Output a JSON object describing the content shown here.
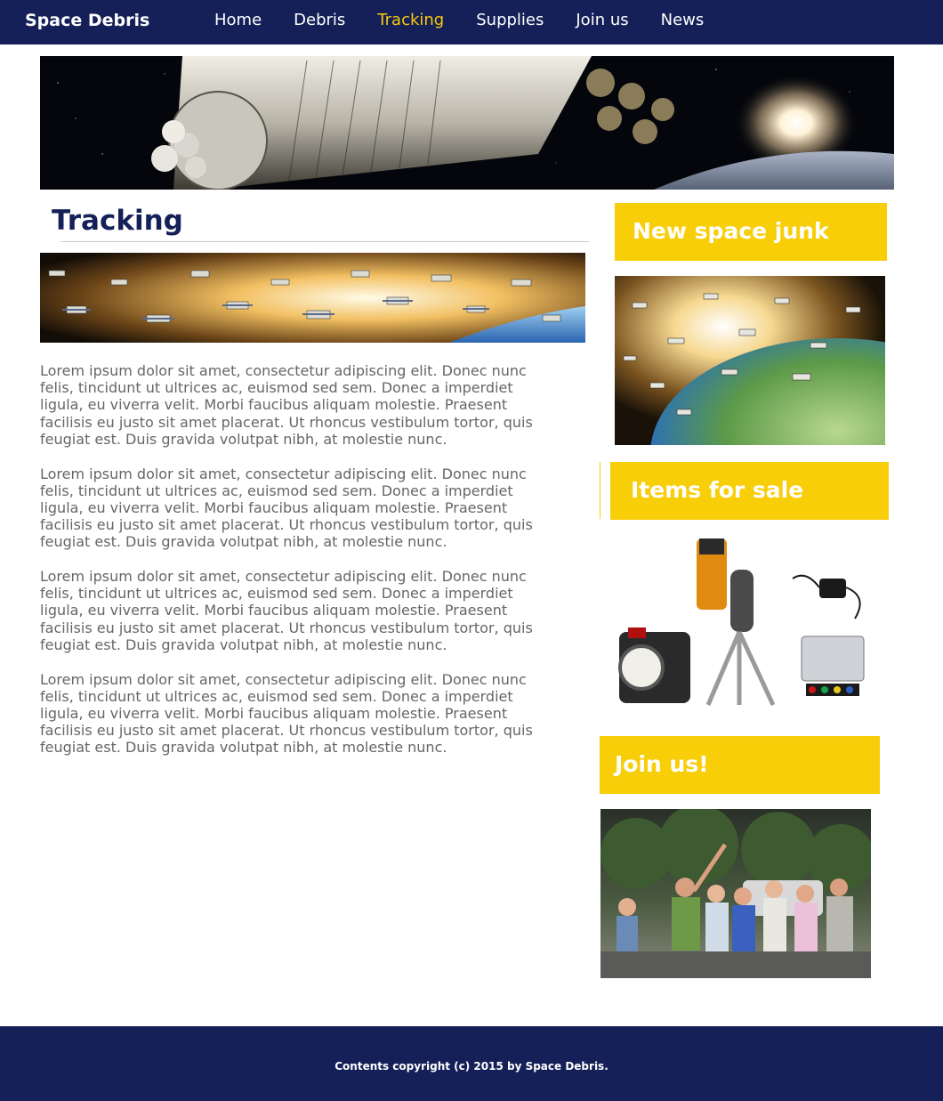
{
  "nav": {
    "brand": "Space Debris",
    "links": [
      {
        "label": "Home",
        "active": false
      },
      {
        "label": "Debris",
        "active": false
      },
      {
        "label": "Tracking",
        "active": true
      },
      {
        "label": "Supplies",
        "active": false
      },
      {
        "label": "Join us",
        "active": false
      },
      {
        "label": "News",
        "active": false
      }
    ]
  },
  "main": {
    "title": "Tracking",
    "paragraphs": [
      "Lorem ipsum dolor sit amet, consectetur adipiscing elit. Donec nunc felis, tincidunt ut ultrices ac, euismod sed sem. Donec a imperdiet ligula, eu viverra velit. Morbi faucibus aliquam molestie. Praesent facilisis eu justo sit amet placerat. Ut rhoncus vestibulum tortor, quis feugiat est. Duis gravida volutpat nibh, at molestie nunc.",
      "Lorem ipsum dolor sit amet, consectetur adipiscing elit. Donec nunc felis, tincidunt ut ultrices ac, euismod sed sem. Donec a imperdiet ligula, eu viverra velit. Morbi faucibus aliquam molestie. Praesent facilisis eu justo sit amet placerat. Ut rhoncus vestibulum tortor, quis feugiat est. Duis gravida volutpat nibh, at molestie nunc.",
      "Lorem ipsum dolor sit amet, consectetur adipiscing elit. Donec nunc felis, tincidunt ut ultrices ac, euismod sed sem. Donec a imperdiet ligula, eu viverra velit. Morbi faucibus aliquam molestie. Praesent facilisis eu justo sit amet placerat. Ut rhoncus vestibulum tortor, quis feugiat est. Duis gravida volutpat nibh, at molestie nunc.",
      "Lorem ipsum dolor sit amet, consectetur adipiscing elit. Donec nunc felis, tincidunt ut ultrices ac, euismod sed sem. Donec a imperdiet ligula, eu viverra velit. Morbi faucibus aliquam molestie. Praesent facilisis eu justo sit amet placerat. Ut rhoncus vestibulum tortor, quis feugiat est. Duis gravida volutpat nibh, at molestie nunc."
    ]
  },
  "sidebar": {
    "new_junk_heading": "New space junk",
    "items_heading": "Items for sale",
    "join_heading": "Join us!"
  },
  "footer": {
    "copyright": "Contents copyright (c) 2015 by Space Debris."
  },
  "colors": {
    "navy": "#142057",
    "accent_yellow": "#f8ce09",
    "active_link": "#f8c80c",
    "body_text": "#666666"
  }
}
